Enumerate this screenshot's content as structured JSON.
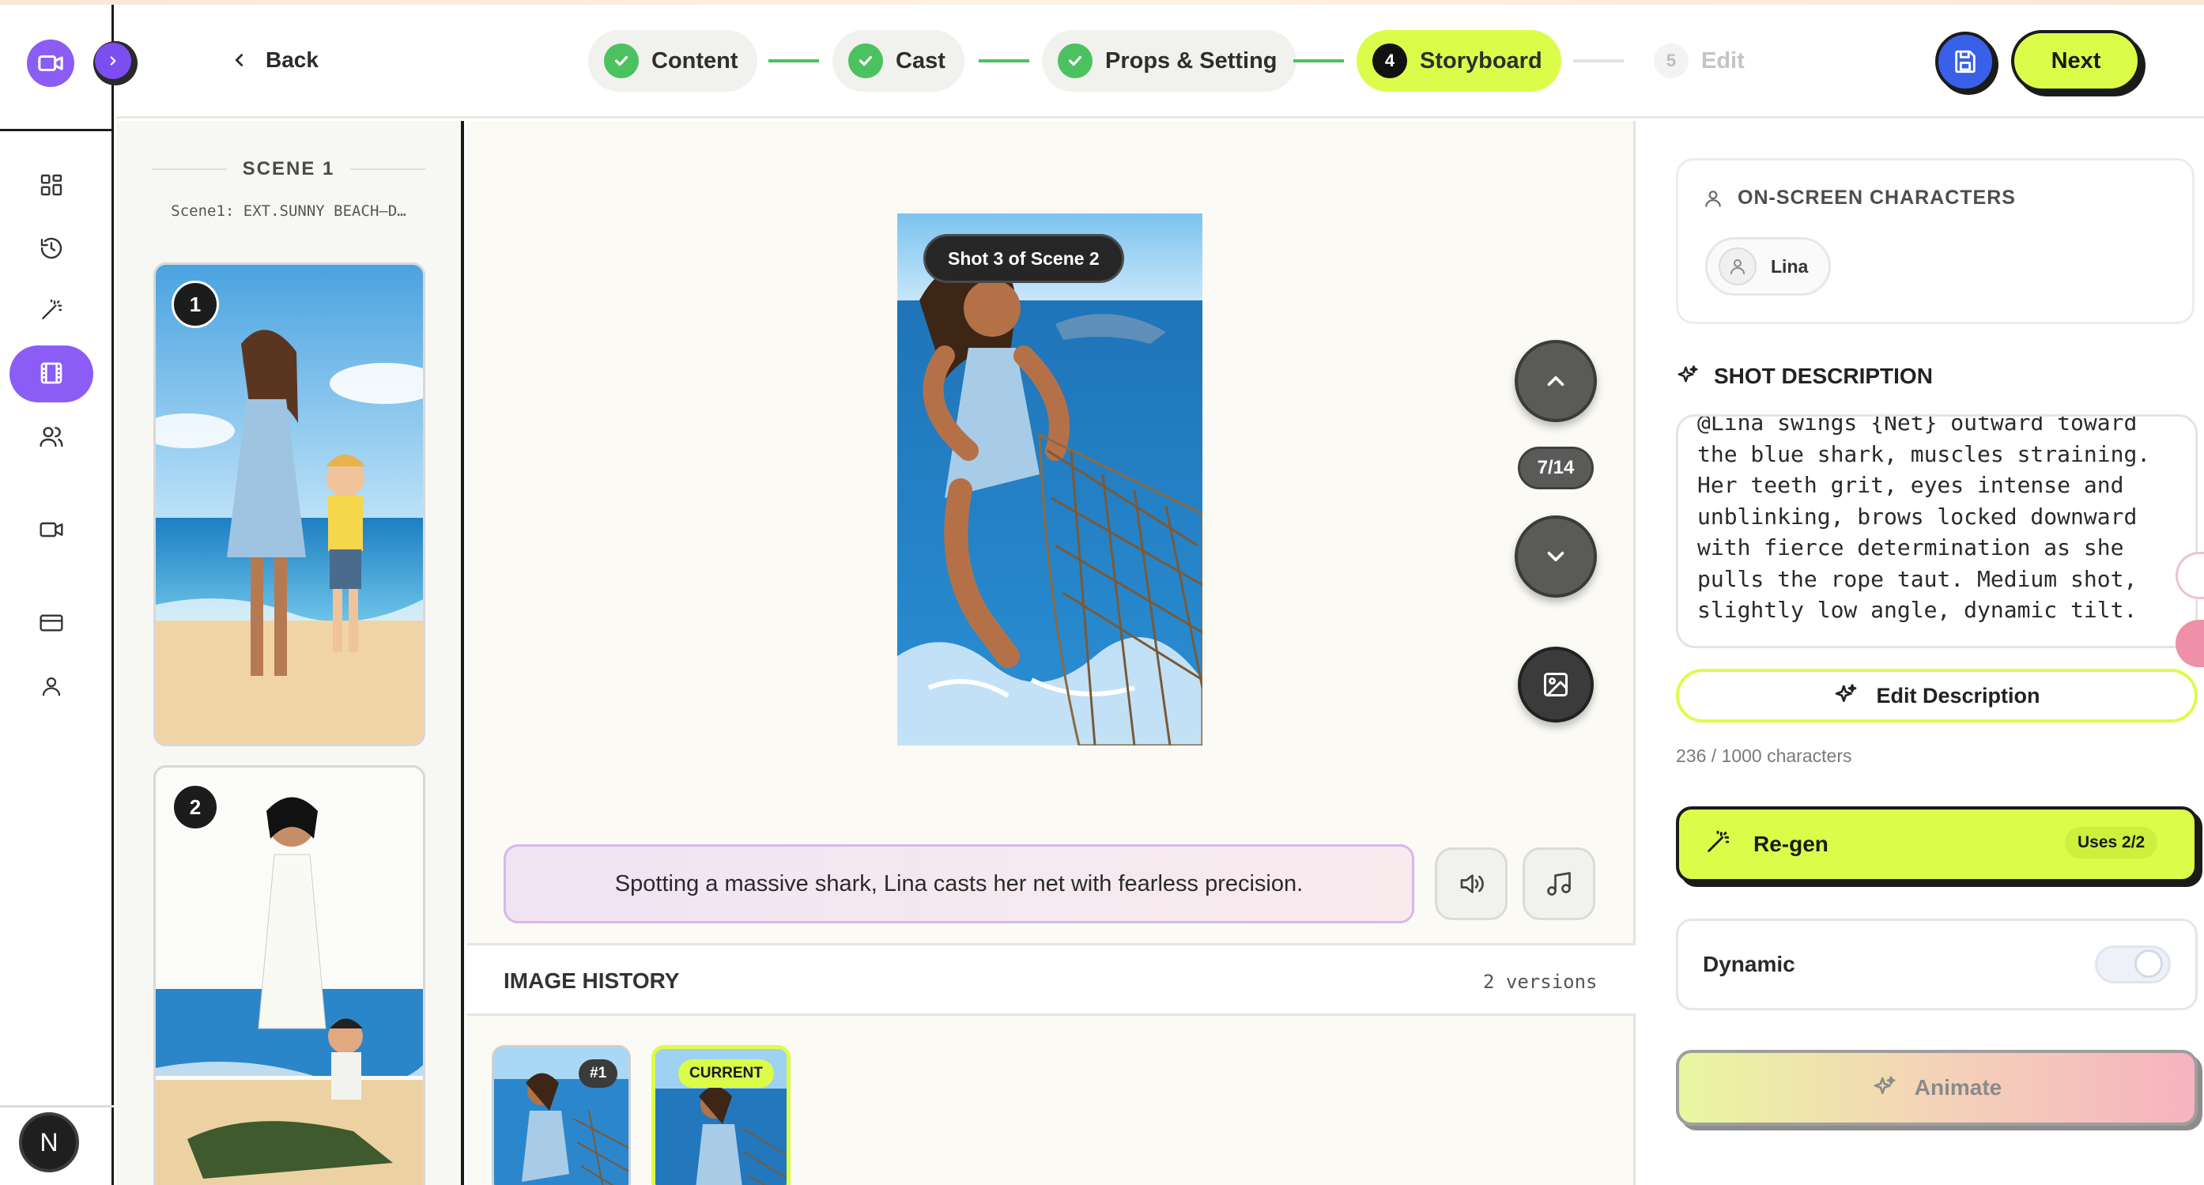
{
  "app": {
    "back_label": "Back",
    "accent": "#dcfc4a",
    "brand": "#8b5cf6"
  },
  "rail": {
    "items": [
      {
        "name": "dashboard",
        "icon": "grid-icon"
      },
      {
        "name": "history",
        "icon": "history-icon"
      },
      {
        "name": "magic",
        "icon": "magic-wand-icon"
      },
      {
        "name": "storyboard",
        "icon": "film-icon",
        "active": true
      },
      {
        "name": "cast",
        "icon": "users-icon"
      },
      {
        "name": "video",
        "icon": "video-icon"
      },
      {
        "name": "billing",
        "icon": "credit-card-icon"
      },
      {
        "name": "profile",
        "icon": "user-icon"
      }
    ],
    "avatar_initial": "N"
  },
  "stepper": {
    "steps": [
      {
        "label": "Content",
        "state": "done"
      },
      {
        "label": "Cast",
        "state": "done"
      },
      {
        "label": "Props & Setting",
        "state": "done"
      },
      {
        "label": "Storyboard",
        "number": "4",
        "state": "active"
      },
      {
        "label": "Edit",
        "number": "5",
        "state": "disabled"
      }
    ]
  },
  "header": {
    "next_label": "Next"
  },
  "scene": {
    "title": "SCENE 1",
    "subtitle": "Scene1: EXT.SUNNY BEACH–D…",
    "shots": [
      {
        "number": "1"
      },
      {
        "number": "2"
      }
    ]
  },
  "preview": {
    "shot_badge": "Shot 3 of Scene 2",
    "counter": "7/14",
    "caption": "Spotting a massive shark, Lina casts her net with fearless precision."
  },
  "history": {
    "title": "IMAGE HISTORY",
    "count": "2 versions",
    "items": [
      {
        "tag": "#1"
      },
      {
        "tag": "CURRENT"
      }
    ]
  },
  "right": {
    "characters_title": "ON-SCREEN CHARACTERS",
    "characters": [
      "Lina"
    ],
    "description_title": "SHOT DESCRIPTION",
    "description": "@Lina swings {Net} outward toward\nthe blue shark, muscles straining.\nHer teeth grit, eyes intense and\nunblinking, brows locked downward\nwith fierce determination as she\npulls the rope taut. Medium shot,\nslightly low angle, dynamic tilt.",
    "edit_description_label": "Edit Description",
    "char_count": "236 / 1000 characters",
    "regen_label": "Re-gen",
    "uses": "Uses 2/2",
    "dynamic_label": "Dynamic",
    "dynamic_on": false,
    "animate_label": "Animate"
  }
}
